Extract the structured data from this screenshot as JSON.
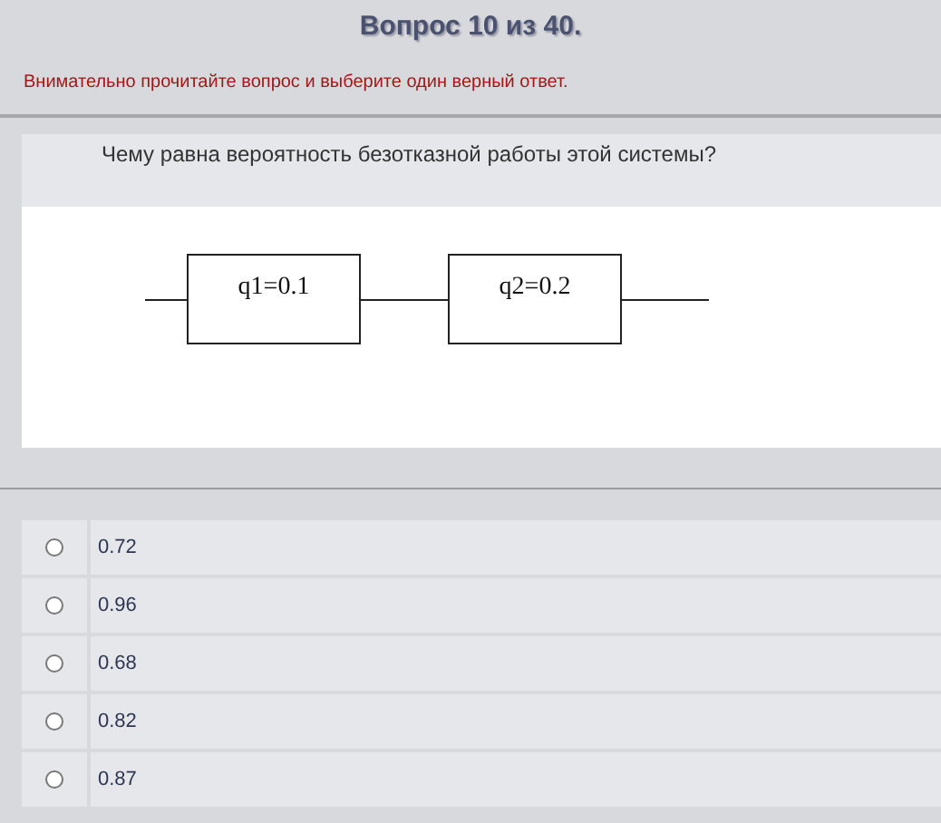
{
  "header": {
    "title": "Вопрос 10 из 40.",
    "instruction": "Внимательно прочитайте вопрос и выберите один верный ответ."
  },
  "question": {
    "text": "Чему равна вероятность безотказной работы этой системы?",
    "diagram": {
      "blocks": [
        "q1=0.1",
        "q2=0.2"
      ]
    }
  },
  "options": [
    {
      "label": "0.72",
      "selected": false
    },
    {
      "label": "0.96",
      "selected": false
    },
    {
      "label": "0.68",
      "selected": false
    },
    {
      "label": "0.82",
      "selected": false
    },
    {
      "label": "0.87",
      "selected": false
    }
  ]
}
